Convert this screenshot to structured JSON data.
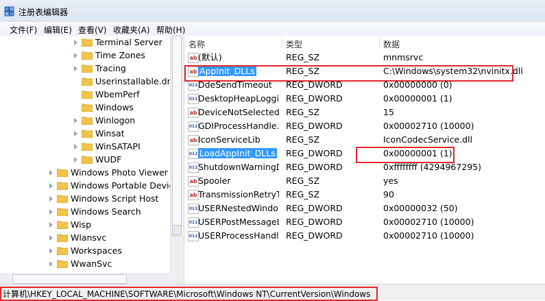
{
  "window": {
    "title": "注册表编辑器"
  },
  "menu": [
    "文件(F)",
    "编辑(E)",
    "查看(V)",
    "收藏夹(A)",
    "帮助(H)"
  ],
  "tree": {
    "items": [
      {
        "label": "Terminal Server",
        "depth": 1,
        "expandable": true
      },
      {
        "label": "Time Zones",
        "depth": 1,
        "expandable": true
      },
      {
        "label": "Tracing",
        "depth": 1,
        "expandable": true
      },
      {
        "label": "Userinstallable.drive",
        "depth": 1,
        "expandable": false
      },
      {
        "label": "WbemPerf",
        "depth": 1,
        "expandable": false
      },
      {
        "label": "Windows",
        "depth": 1,
        "expandable": false
      },
      {
        "label": "Winlogon",
        "depth": 1,
        "expandable": true
      },
      {
        "label": "Winsat",
        "depth": 1,
        "expandable": true
      },
      {
        "label": "WinSATAPI",
        "depth": 1,
        "expandable": true
      },
      {
        "label": "WUDF",
        "depth": 1,
        "expandable": true
      },
      {
        "label": "Windows Photo Viewer",
        "depth": 0,
        "expandable": true
      },
      {
        "label": "Windows Portable Devices",
        "depth": 0,
        "expandable": true
      },
      {
        "label": "Windows Script Host",
        "depth": 0,
        "expandable": true
      },
      {
        "label": "Windows Search",
        "depth": 0,
        "expandable": true
      },
      {
        "label": "Wisp",
        "depth": 0,
        "expandable": true
      },
      {
        "label": "Wlansvc",
        "depth": 0,
        "expandable": true
      },
      {
        "label": "Workspaces",
        "depth": 0,
        "expandable": true
      },
      {
        "label": "WwanSvc",
        "depth": 0,
        "expandable": true
      }
    ]
  },
  "list": {
    "headers": {
      "name": "名称",
      "type": "类型",
      "data": "数据"
    },
    "rows": [
      {
        "name": "(默认)",
        "type": "REG_SZ",
        "data": "mnmsrvc",
        "kind": "sz"
      },
      {
        "name": "AppInit_DLLs",
        "type": "REG_SZ",
        "data": "C:\\Windows\\system32\\nvinitx.dll",
        "kind": "sz",
        "selected": true
      },
      {
        "name": "DdeSendTimeout",
        "type": "REG_DWORD",
        "data": "0x00000000 (0)",
        "kind": "dword"
      },
      {
        "name": "DesktopHeapLoggi...",
        "type": "REG_DWORD",
        "data": "0x00000001 (1)",
        "kind": "dword"
      },
      {
        "name": "DeviceNotSelectedT...",
        "type": "REG_SZ",
        "data": "15",
        "kind": "sz"
      },
      {
        "name": "GDIProcessHandle...",
        "type": "REG_DWORD",
        "data": "0x00002710 (10000)",
        "kind": "dword"
      },
      {
        "name": "IconServiceLib",
        "type": "REG_SZ",
        "data": "IconCodecService.dll",
        "kind": "sz"
      },
      {
        "name": "LoadAppInit_DLLs",
        "type": "REG_DWORD",
        "data": "0x00000001 (1)",
        "kind": "dword",
        "selected": true
      },
      {
        "name": "ShutdownWarningD...",
        "type": "REG_DWORD",
        "data": "0xffffffff (4294967295)",
        "kind": "dword"
      },
      {
        "name": "Spooler",
        "type": "REG_SZ",
        "data": "yes",
        "kind": "sz"
      },
      {
        "name": "TransmissionRetryTi...",
        "type": "REG_SZ",
        "data": "90",
        "kind": "sz"
      },
      {
        "name": "USERNestedWindo...",
        "type": "REG_DWORD",
        "data": "0x00000032 (50)",
        "kind": "dword"
      },
      {
        "name": "USERPostMessageL...",
        "type": "REG_DWORD",
        "data": "0x00002710 (10000)",
        "kind": "dword"
      },
      {
        "name": "USERProcessHandle...",
        "type": "REG_DWORD",
        "data": "0x00002710 (10000)",
        "kind": "dword"
      }
    ]
  },
  "status": {
    "path": "计算机\\HKEY_LOCAL_MACHINE\\SOFTWARE\\Microsoft\\Windows NT\\CurrentVersion\\Windows"
  },
  "colors": {
    "selection": "#3399ff",
    "highlight_box": "#e0262d",
    "folder": "#f2c44b"
  }
}
